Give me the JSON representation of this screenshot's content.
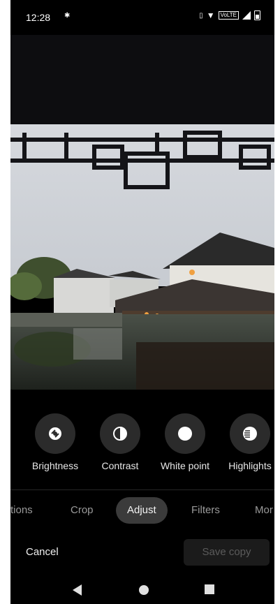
{
  "status_bar": {
    "time": "12:28",
    "network_label": "VoLTE"
  },
  "photo": {
    "description_icon": "photo-canvas"
  },
  "adjust_tools": [
    {
      "label": "Brightness",
      "icon": "brightness-icon"
    },
    {
      "label": "Contrast",
      "icon": "contrast-icon"
    },
    {
      "label": "White point",
      "icon": "white-point-icon"
    },
    {
      "label": "Highlights",
      "icon": "highlights-icon"
    }
  ],
  "tabs": [
    {
      "label": "tions"
    },
    {
      "label": "Crop"
    },
    {
      "label": "Adjust",
      "active": true
    },
    {
      "label": "Filters"
    },
    {
      "label": "Mor"
    }
  ],
  "actions": {
    "cancel_label": "Cancel",
    "save_label": "Save copy"
  },
  "nav": {
    "back_icon": "back-icon",
    "home_icon": "home-icon",
    "recents_icon": "recents-icon"
  },
  "colors": {
    "background": "#000000",
    "tool_circle": "#2b2b2b",
    "active_tab": "#3b3b3b"
  }
}
